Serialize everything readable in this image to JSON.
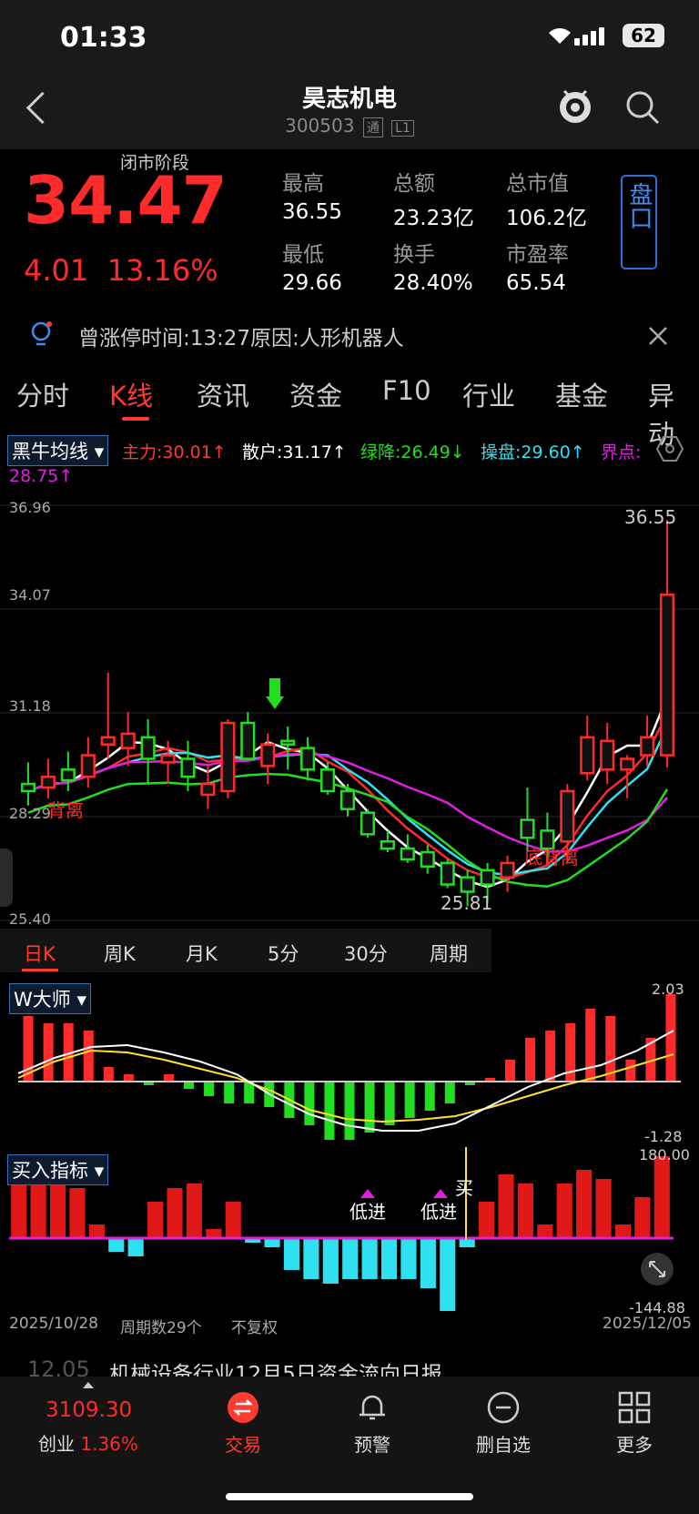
{
  "status_bar": {
    "time": "01:33",
    "battery": "62"
  },
  "header": {
    "title": "昊志机电",
    "code": "300503",
    "tag1": "通",
    "tag2": "L1"
  },
  "quote": {
    "phase": "闭市阶段",
    "price": "34.47",
    "change": "4.01",
    "change_pct": "13.16%",
    "stats": [
      {
        "label": "最高",
        "value": "36.55"
      },
      {
        "label": "总额",
        "value": "23.23亿"
      },
      {
        "label": "总市值",
        "value": "106.2亿"
      },
      {
        "label": "最低",
        "value": "29.66"
      },
      {
        "label": "换手",
        "value": "28.40%"
      },
      {
        "label": "市盈率",
        "value": "65.54"
      }
    ],
    "pankou": "盘口"
  },
  "notice": {
    "text": "曾涨停时间:13:27原因:人形机器人"
  },
  "tabs": [
    "分时",
    "K线",
    "资讯",
    "资金",
    "F10",
    "行业",
    "基金",
    "异动"
  ],
  "active_tab": "K线",
  "indicator": {
    "name": "黑牛均线",
    "zhuli": "主力:30.01↑",
    "sanhu": "散户:31.17↑",
    "lvjiang": "绿降:26.49↓",
    "caopan": "操盘:29.60↑",
    "jiedian": "界点:",
    "jiedian_val": "28.75↑"
  },
  "colors": {
    "up": "#ff2a2a",
    "down": "#22dd22",
    "accent": "#ff3b30",
    "blue": "#3b8ef0",
    "cyan": "#2fe0f0",
    "magenta": "#e020e0",
    "yellow": "#ffe030"
  },
  "main_chart": {
    "yticks": [
      "36.96",
      "34.07",
      "31.18",
      "28.29",
      "25.40"
    ],
    "high_label": "36.55",
    "low_label": "25.81",
    "annot_left": "背离",
    "annot_right": "底背离"
  },
  "period_tabs": [
    "日K",
    "周K",
    "月K",
    "5分",
    "30分",
    "周期"
  ],
  "sub1": {
    "name": "W大师",
    "top": "2.03",
    "bottom": "-1.28"
  },
  "sub2": {
    "name": "买入指标",
    "top": "180.00",
    "bottom": "-144.88",
    "buy_text1": "低进",
    "buy_text2": "低进",
    "buy_text3": "买"
  },
  "footer": {
    "start_date": "2025/10/28",
    "period_count": "周期数29个",
    "adjust": "不复权",
    "end_date": "2025/12/05"
  },
  "news": {
    "date": "12.05",
    "text": "机械设备行业12月5日资金流向日报"
  },
  "bottom_nav": {
    "index_value": "3109.30",
    "index_name": "创业",
    "index_pct": "1.36%",
    "items": [
      "交易",
      "预警",
      "删自选",
      "更多"
    ]
  },
  "chart_data": {
    "type": "candlestick",
    "ylim": [
      25.4,
      36.96
    ],
    "ohlc": [
      [
        29.2,
        29.8,
        28.6,
        29.0
      ],
      [
        29.1,
        29.9,
        28.8,
        29.4
      ],
      [
        29.6,
        30.1,
        29.0,
        29.3
      ],
      [
        29.4,
        30.5,
        29.1,
        30.0
      ],
      [
        30.3,
        32.3,
        29.9,
        30.5
      ],
      [
        30.2,
        31.2,
        29.7,
        30.6
      ],
      [
        30.5,
        31.0,
        29.2,
        29.9
      ],
      [
        29.8,
        30.4,
        29.2,
        30.0
      ],
      [
        29.9,
        30.4,
        29.0,
        29.4
      ],
      [
        28.9,
        29.7,
        28.5,
        29.2
      ],
      [
        29.0,
        31.0,
        28.8,
        30.9
      ],
      [
        30.9,
        31.2,
        29.9,
        29.9
      ],
      [
        29.7,
        30.6,
        29.2,
        30.3
      ],
      [
        30.4,
        30.8,
        29.6,
        30.3
      ],
      [
        30.2,
        30.5,
        29.3,
        29.6
      ],
      [
        29.6,
        29.8,
        28.9,
        29.0
      ],
      [
        29.0,
        29.2,
        28.3,
        28.5
      ],
      [
        28.4,
        28.5,
        27.7,
        27.8
      ],
      [
        27.6,
        27.9,
        27.3,
        27.4
      ],
      [
        27.4,
        27.8,
        27.0,
        27.1
      ],
      [
        27.3,
        27.5,
        26.7,
        26.9
      ],
      [
        27.0,
        27.1,
        26.3,
        26.4
      ],
      [
        26.6,
        26.8,
        25.8,
        26.2
      ],
      [
        26.8,
        27.0,
        25.9,
        26.4
      ],
      [
        26.6,
        27.2,
        26.2,
        27.0
      ],
      [
        28.2,
        29.1,
        27.3,
        27.7
      ],
      [
        27.9,
        28.4,
        27.0,
        27.4
      ],
      [
        27.6,
        29.2,
        27.0,
        29.0
      ],
      [
        29.5,
        31.1,
        29.3,
        30.5
      ],
      [
        29.6,
        30.9,
        29.2,
        30.4
      ],
      [
        29.6,
        30.0,
        28.8,
        29.9
      ],
      [
        30.0,
        31.1,
        29.7,
        30.5
      ],
      [
        30.0,
        36.55,
        29.66,
        34.47
      ]
    ]
  }
}
